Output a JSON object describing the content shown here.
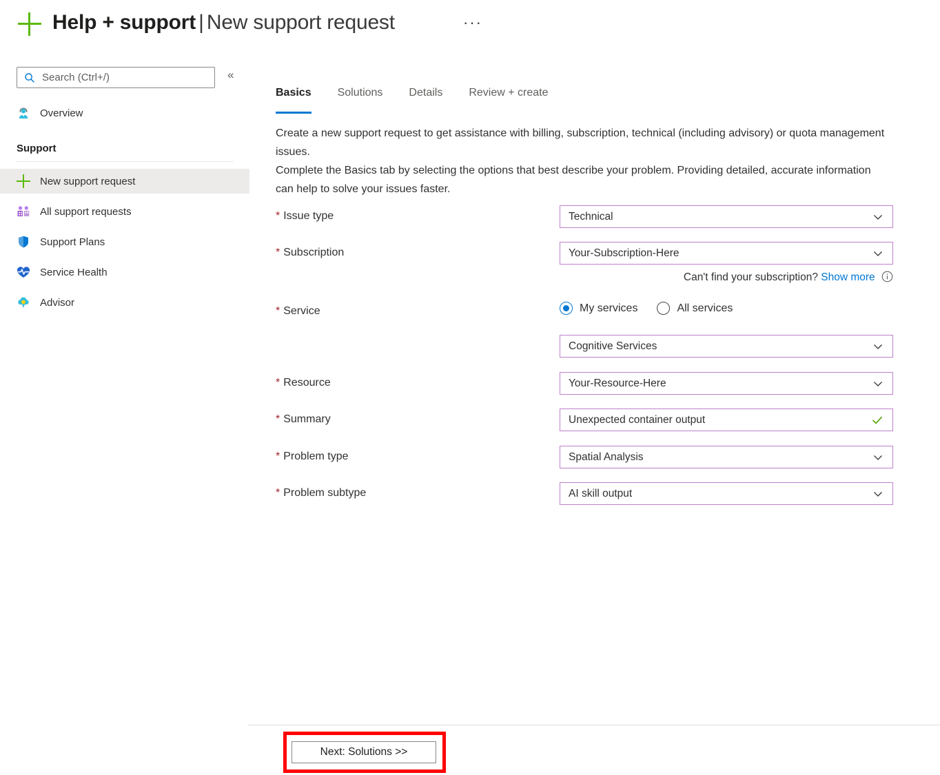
{
  "header": {
    "plus_icon": "plus-icon",
    "title_main": "Help + support",
    "title_separator": "|",
    "title_sub": "New support request",
    "more_menu": "···"
  },
  "sidebar": {
    "search": {
      "placeholder": "Search (Ctrl+/)",
      "value": "",
      "icon": "search-icon"
    },
    "collapse_label": "«",
    "overview": {
      "label": "Overview",
      "icon": "agent-person-icon"
    },
    "section_title": "Support",
    "items": [
      {
        "label": "New support request",
        "icon": "plus-icon",
        "selected": true
      },
      {
        "label": "All support requests",
        "icon": "people-group-icon",
        "selected": false
      },
      {
        "label": "Support Plans",
        "icon": "shield-icon",
        "selected": false
      },
      {
        "label": "Service Health",
        "icon": "heart-pulse-icon",
        "selected": false
      },
      {
        "label": "Advisor",
        "icon": "advisor-cloud-icon",
        "selected": false
      }
    ]
  },
  "main": {
    "tabs": [
      {
        "label": "Basics",
        "active": true
      },
      {
        "label": "Solutions",
        "active": false
      },
      {
        "label": "Details",
        "active": false
      },
      {
        "label": "Review + create",
        "active": false
      }
    ],
    "description_line1": "Create a new support request to get assistance with billing, subscription, technical (including advisory) or quota management issues.",
    "description_line2": "Complete the Basics tab by selecting the options that best describe your problem. Providing detailed, accurate information can help to solve your issues faster.",
    "required_marker": "*",
    "fields": {
      "issue_type": {
        "label": "Issue type",
        "value": "Technical"
      },
      "subscription": {
        "label": "Subscription",
        "value": "Your-Subscription-Here"
      },
      "service": {
        "label": "Service",
        "value": "Cognitive Services"
      },
      "resource": {
        "label": "Resource",
        "value": "Your-Resource-Here"
      },
      "summary": {
        "label": "Summary",
        "value": "Unexpected container output"
      },
      "problem_type": {
        "label": "Problem type",
        "value": "Spatial Analysis"
      },
      "problem_subtype": {
        "label": "Problem subtype",
        "value": "AI skill output"
      }
    },
    "subscription_hint": {
      "text": "Can't find your subscription?",
      "link": "Show more",
      "info_icon": "info-icon"
    },
    "service_radios": [
      {
        "label": "My services",
        "selected": true
      },
      {
        "label": "All services",
        "selected": false
      }
    ],
    "summary_valid_icon": "checkmark-icon"
  },
  "footer": {
    "next_button": "Next: Solutions >>"
  },
  "colors": {
    "accent_blue": "#0078d4",
    "plus_green": "#5BB907",
    "field_border_purple": "#bf80cc",
    "required_red": "#a4262c",
    "valid_green": "#57a300",
    "highlight_red": "#ff0000",
    "selected_row_grey": "#edebe9"
  }
}
